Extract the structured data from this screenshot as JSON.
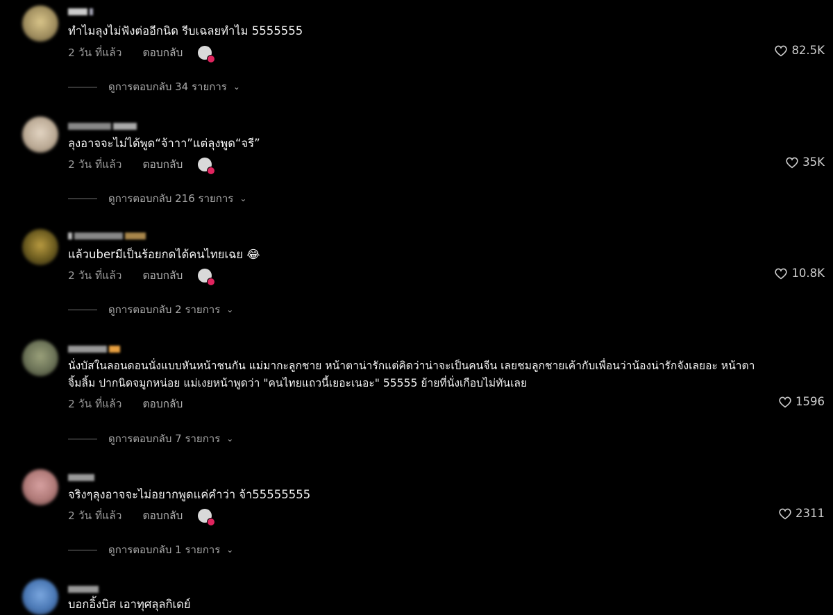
{
  "comments": [
    {
      "text": "ทำไมลุงไม่ฟังต่ออีกนิด รีบเฉลยทำไม 5555555",
      "time": "2 วัน ที่แล้ว",
      "reply_label": "ตอบกลับ",
      "likes": "82.5K",
      "replies_label": "ดูการตอบกลับ 34 รายการ",
      "avatar_color": "#9c8a5c"
    },
    {
      "text": "ลุงอาจจะไม่ได้พูด“จ้าาา”แต่ลุงพูด“จรี”",
      "time": "2 วัน ที่แล้ว",
      "reply_label": "ตอบกลับ",
      "likes": "35K",
      "replies_label": "ดูการตอบกลับ 216 รายการ",
      "avatar_color": "#b8a792"
    },
    {
      "text": "แล้วuberมีเป็นร้อยกดได้คนไทยเฉย 😂",
      "time": "2 วัน ที่แล้ว",
      "reply_label": "ตอบกลับ",
      "likes": "10.8K",
      "replies_label": "ดูการตอบกลับ 2 รายการ",
      "avatar_color": "#6a5a1e"
    },
    {
      "text_line1": "นั่งบัสในลอนดอนนั่งแบบหันหน้าชนกัน แม่มากะลูกชาย หน้าตาน่ารักแต่คิดว่าน่าจะเป็นคนจีน เลยชมลูกชายเค้ากับเพื่อนว่าน้องน่ารักจังเลยอะ หน้าตา",
      "text_line2": "จิ้มลิ้ม ปากนิดจมูกหน่อย แม่เงยหน้าพูดว่า \"คนไทยแถวนี้เยอะเนอะ\" 55555 ย้ายที่นั่งเกือบไม่ทันเลย",
      "time": "2 วัน ที่แล้ว",
      "reply_label": "ตอบกลับ",
      "likes": "1596",
      "replies_label": "ดูการตอบกลับ 7 รายการ",
      "avatar_color": "#6b7257"
    },
    {
      "text": "จริงๆลุงอาจจะไม่อยากพูดแค่คำว่า จ้า55555555",
      "time": "2 วัน ที่แล้ว",
      "reply_label": "ตอบกลับ",
      "likes": "2311",
      "replies_label": "ดูการตอบกลับ 1 รายการ",
      "avatar_color": "#b07a78"
    },
    {
      "text": "บอกอิ้งบิส เอาทุศลุลกิเดย์",
      "avatar_color": "#4a78b5"
    }
  ],
  "icons": {
    "heart": "heart-icon",
    "chevron": "chevron-down-icon"
  },
  "colors": {
    "background": "#000000",
    "creator_badge": "#e0245e"
  }
}
